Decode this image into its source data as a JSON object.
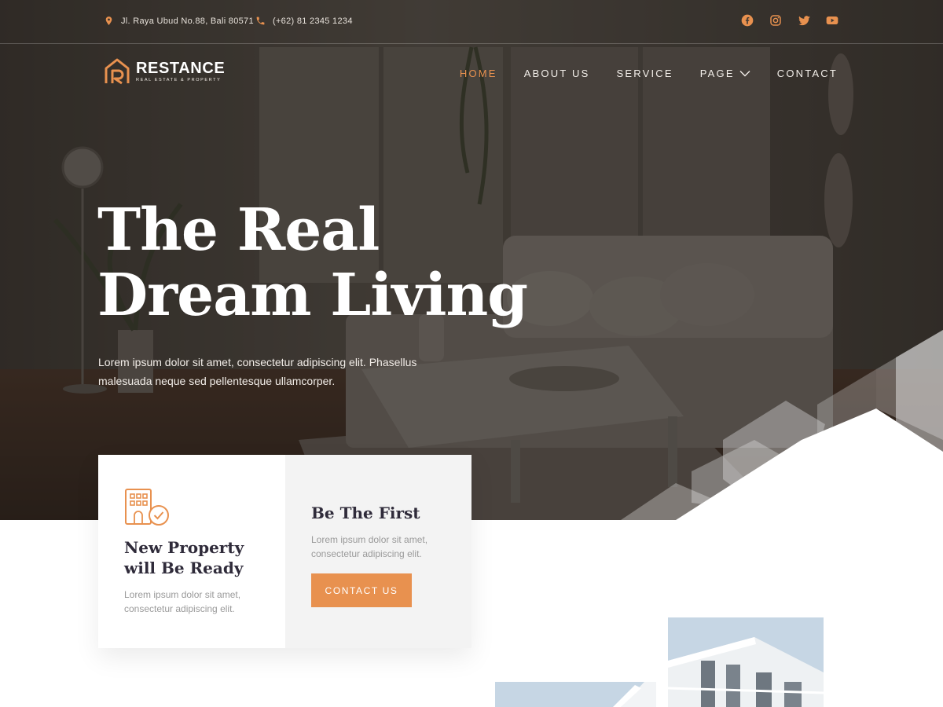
{
  "topbar": {
    "address": "Jl. Raya Ubud No.88, Bali 80571",
    "phone": "(+62) 81 2345 1234",
    "socials": [
      "facebook-icon",
      "instagram-icon",
      "twitter-icon",
      "youtube-icon"
    ]
  },
  "brand": {
    "name": "RESTANCE",
    "tagline": "REAL ESTATE & PROPERTY"
  },
  "nav": {
    "items": [
      {
        "label": "HOME",
        "active": true
      },
      {
        "label": "ABOUT US",
        "active": false
      },
      {
        "label": "SERVICE",
        "active": false
      },
      {
        "label": "PAGE",
        "active": false
      },
      {
        "label": "CONTACT",
        "active": false
      }
    ]
  },
  "hero": {
    "title_line1": "The Real",
    "title_line2": "Dream Living",
    "text": "Lorem ipsum dolor sit amet, consectetur adipiscing elit. Phasellus malesuada neque sed pellentesque ullamcorper."
  },
  "cards": {
    "left": {
      "title": "New Property will Be Ready",
      "text": "Lorem ipsum dolor sit amet, consectetur adipiscing elit."
    },
    "right": {
      "title": "Be The First",
      "text": "Lorem ipsum dolor sit amet, consectetur adipiscing elit.",
      "button_label": "CONTACT US"
    }
  },
  "colors": {
    "accent": "#e8914f",
    "heading": "#2f2b3a",
    "muted": "#9a9a9a",
    "card_alt": "#f3f3f3"
  }
}
